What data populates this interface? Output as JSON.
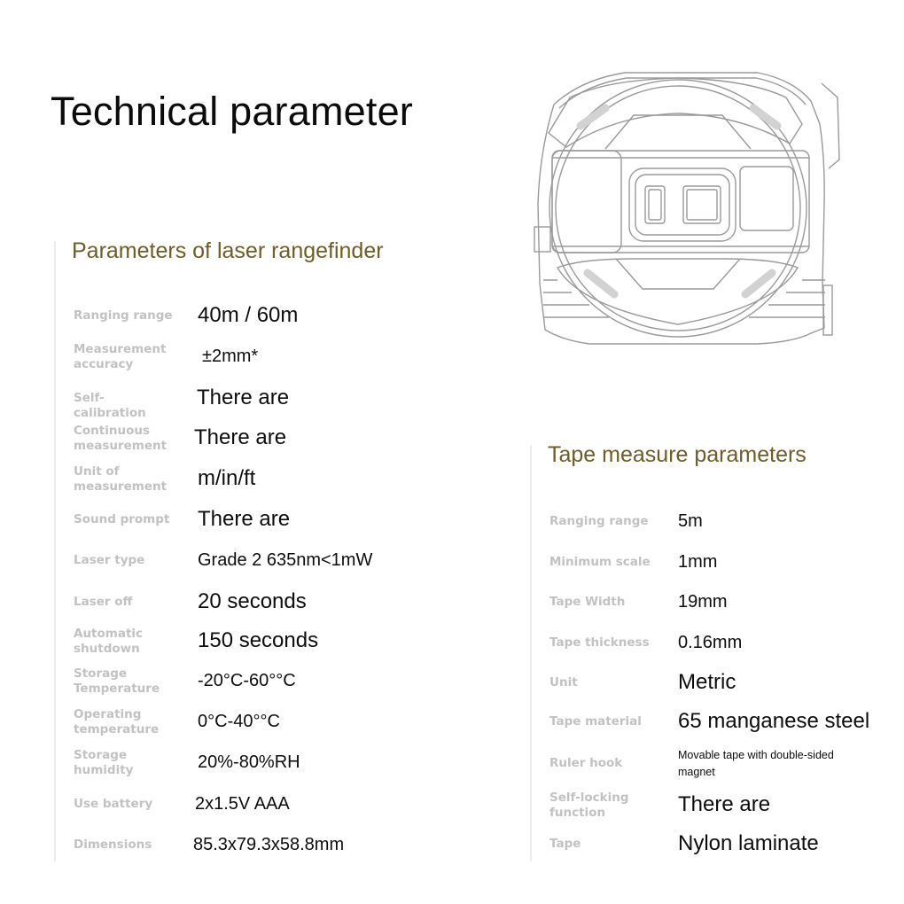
{
  "page": {
    "title": "Technical parameter"
  },
  "laser": {
    "heading": "Parameters of laser rangefinder",
    "rows": [
      {
        "label": "Ranging range",
        "value": "40m / 60m"
      },
      {
        "label": "Measurement accuracy",
        "value": "±2mm*"
      },
      {
        "label": "Self-calibration",
        "value": "There are"
      },
      {
        "label": "Continuous measurement",
        "value": "There are"
      },
      {
        "label": "Unit of measurement",
        "value": "m/in/ft"
      },
      {
        "label": "Sound prompt",
        "value": "There are"
      },
      {
        "label": "Laser type",
        "value": "Grade 2 635nm<1mW"
      },
      {
        "label": "Laser off",
        "value": "20 seconds"
      },
      {
        "label": "Automatic shutdown",
        "value": "150 seconds"
      },
      {
        "label": "Storage Temperature",
        "value": "-20°C-60°°C"
      },
      {
        "label": "Operating temperature",
        "value": "0°C-40°°C"
      },
      {
        "label": "Storage humidity",
        "value": "20%-80%RH"
      },
      {
        "label": "Use battery",
        "value": "2x1.5V AAA"
      },
      {
        "label": "Dimensions",
        "value": "85.3x79.3x58.8mm"
      }
    ]
  },
  "tape": {
    "heading": "Tape measure parameters",
    "rows": [
      {
        "label": "Ranging range",
        "value": "5m"
      },
      {
        "label": "Minimum scale",
        "value": "1mm"
      },
      {
        "label": "Tape Width",
        "value": "19mm"
      },
      {
        "label": "Tape thickness",
        "value": "0.16mm"
      },
      {
        "label": "Unit",
        "value": "Metric"
      },
      {
        "label": "Tape material",
        "value": "65 manganese steel"
      },
      {
        "label": "Ruler hook",
        "value": "Movable tape with double-sided magnet"
      },
      {
        "label": "Self-locking function",
        "value": "There are"
      },
      {
        "label": "Tape",
        "value": "Nylon laminate"
      }
    ]
  },
  "image": {
    "icon": "laser-tape-measure-line-drawing"
  },
  "colors": {
    "heading_accent": "#6f5c26",
    "label_gray": "#c2c2c2",
    "value_black": "#0d0d0d"
  }
}
